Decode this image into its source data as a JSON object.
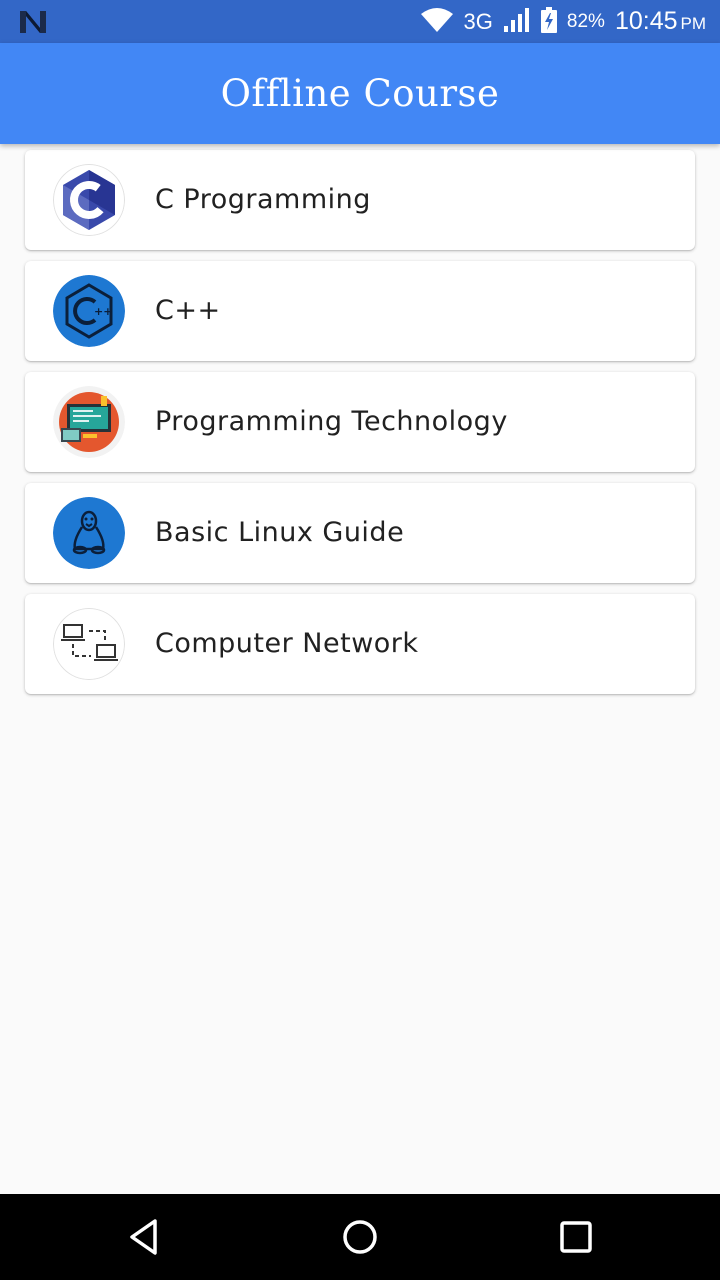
{
  "status_bar": {
    "network": "3G",
    "battery": "82%",
    "time": "10:45",
    "ampm": "PM",
    "icons": [
      "notification-n-icon",
      "wifi-icon",
      "signal-icon",
      "battery-icon"
    ]
  },
  "app_bar": {
    "title": "Offline Course",
    "color": "#4287f5"
  },
  "courses": [
    {
      "label": "C Programming",
      "icon": "c-language-icon"
    },
    {
      "label": "C++",
      "icon": "cpp-language-icon"
    },
    {
      "label": "Programming Technology",
      "icon": "programming-technology-icon"
    },
    {
      "label": "Basic Linux Guide",
      "icon": "linux-tux-icon"
    },
    {
      "label": "Computer Network",
      "icon": "computer-network-icon"
    }
  ],
  "nav_bar": {
    "icons": [
      "back-icon",
      "home-icon",
      "recents-icon"
    ]
  }
}
